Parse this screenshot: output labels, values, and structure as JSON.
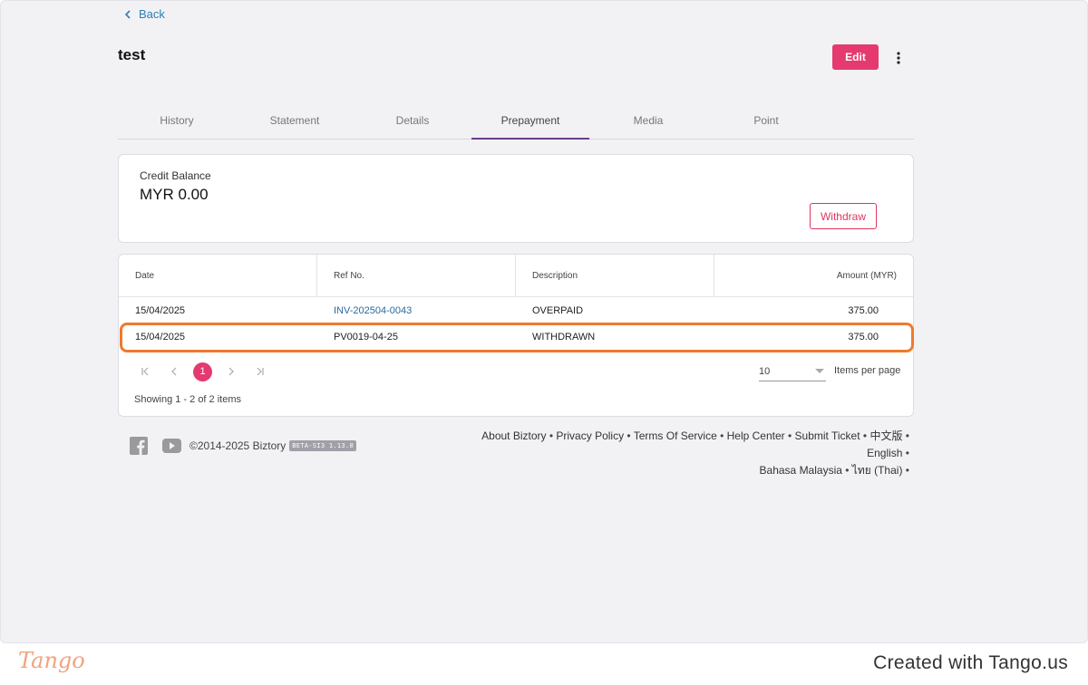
{
  "nav": {
    "back_label": "Back"
  },
  "page": {
    "title": "test"
  },
  "actions": {
    "edit_label": "Edit"
  },
  "tabs": [
    {
      "label": "History",
      "active": false
    },
    {
      "label": "Statement",
      "active": false
    },
    {
      "label": "Details",
      "active": false
    },
    {
      "label": "Prepayment",
      "active": true
    },
    {
      "label": "Media",
      "active": false
    },
    {
      "label": "Point",
      "active": false
    }
  ],
  "balance": {
    "label": "Credit Balance",
    "value": "MYR 0.00",
    "withdraw_label": "Withdraw"
  },
  "table": {
    "columns": [
      "Date",
      "Ref No.",
      "Description",
      "Amount (MYR)"
    ],
    "rows": [
      {
        "date": "15/04/2025",
        "ref": "INV-202504-0043",
        "description": "OVERPAID",
        "amount": "375.00"
      },
      {
        "date": "15/04/2025",
        "ref": "PV0019-04-25",
        "description": "WITHDRAWN",
        "amount": "375.00"
      }
    ]
  },
  "pagination": {
    "current_page": "1",
    "per_page": "10",
    "per_page_label": "Items per page",
    "showing": "Showing 1 - 2 of 2 items"
  },
  "footer": {
    "copyright": "©2014-2025 Biztory",
    "version_badge": "BETA-SI3 1.13.0",
    "links": [
      "About Biztory",
      "Privacy Policy",
      "Terms Of Service",
      "Help Center",
      "Submit Ticket",
      "中文版",
      "English",
      "Bahasa Malaysia",
      "ไทย (Thai)"
    ]
  },
  "watermark": {
    "logo": "Tango",
    "credit": "Created with Tango.us"
  },
  "colors": {
    "accent": "#e53a6f",
    "link": "#2a7fb8",
    "tab_active": "#6a3e8e",
    "highlight": "#f07a2d"
  }
}
